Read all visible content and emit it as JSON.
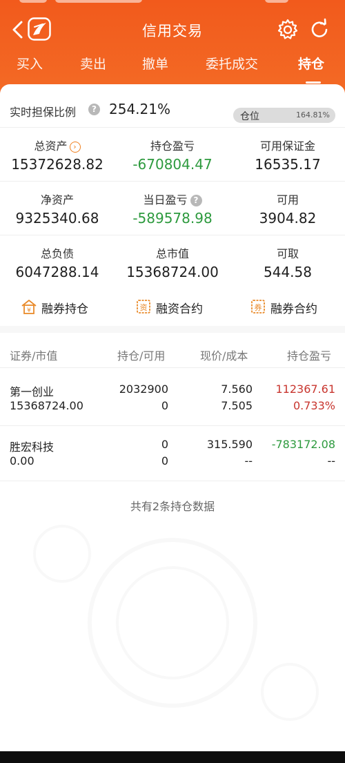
{
  "header": {
    "title": "信用交易",
    "tabs": [
      {
        "label": "买入"
      },
      {
        "label": "卖出"
      },
      {
        "label": "撤单"
      },
      {
        "label": "委托成交"
      },
      {
        "label": "持仓",
        "active": true
      }
    ],
    "icons": {
      "back": "chevron-left-icon",
      "logo": "broker-logo-icon",
      "settings": "gear-icon",
      "refresh": "refresh-icon"
    }
  },
  "summary": {
    "ratio_label": "实时担保比例",
    "ratio_value": "254.21%",
    "position_label": "仓位",
    "position_value": "164.81%",
    "position_level_fraction": 1.0,
    "cells": [
      {
        "label": "总资产",
        "value": "15372628.82"
      },
      {
        "label": "持仓盈亏",
        "value": "-670804.47"
      },
      {
        "label": "可用保证金",
        "value": "16535.17"
      },
      {
        "label": "净资产",
        "value": "9325340.68"
      },
      {
        "label": "当日盈亏",
        "value": "-589578.98"
      },
      {
        "label": "可用",
        "value": "3904.82"
      },
      {
        "label": "总负债",
        "value": "6047288.14"
      },
      {
        "label": "总市值",
        "value": "15368724.00"
      },
      {
        "label": "可取",
        "value": "544.58"
      }
    ]
  },
  "shortcuts": [
    {
      "label": "融券持仓",
      "icon": "house-yen-icon"
    },
    {
      "label": "融资合约",
      "icon": "finance-contract-icon"
    },
    {
      "label": "融券合约",
      "icon": "securities-contract-icon"
    }
  ],
  "holdings": {
    "columns": [
      "证券/市值",
      "持仓/可用",
      "现价/成本",
      "持仓盈亏"
    ],
    "rows": [
      {
        "name": "第一创业",
        "market_value": "15368724.00",
        "position": "2032900",
        "available": "0",
        "price": "7.560",
        "cost": "7.505",
        "pnl": "112367.61",
        "pnl_pct": "0.733%"
      },
      {
        "name": "胜宏科技",
        "market_value": "0.00",
        "position": "0",
        "available": "0",
        "price": "315.590",
        "cost": "--",
        "pnl": "-783172.08",
        "pnl_pct": "--"
      }
    ],
    "footnote": "共有2条持仓数据"
  },
  "colors": {
    "brand": "#f25a1c",
    "loss": "#2d9a3e",
    "gain": "#c8352e"
  }
}
